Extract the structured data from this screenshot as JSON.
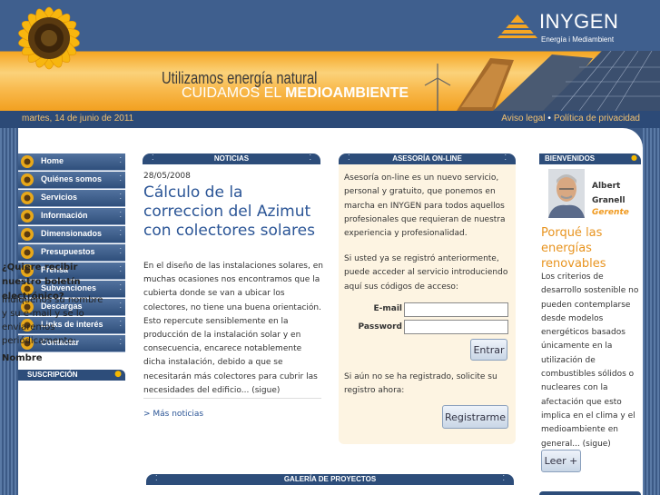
{
  "brand": {
    "name": "INYGEN",
    "tagline": "Energía i Mediambient"
  },
  "slogan": {
    "line1": "Utilizamos energía natural",
    "line2_prefix": "CUIDAMOS EL ",
    "line2_bold": "MEDIOAMBIENTE"
  },
  "datebar": {
    "date": "martes, 14 de junio de 2011",
    "links": [
      "Aviso legal",
      "Política de privacidad"
    ]
  },
  "nav": {
    "items": [
      "Home",
      "Quiénes somos",
      "Servicios",
      "Información",
      "Dimensionados",
      "Presupuestos",
      "Prensa",
      "Subvenciones",
      "Descargas",
      "Links de interés",
      "Contactar"
    ]
  },
  "suscripcion": {
    "header": "SUSCRIPCIÓN",
    "question": "¿Quiere recibir nuestro boletín electrónico?",
    "text": "Indiquenos su nombre y su e-mail y se lo enviaremos periódicamente:",
    "name_label": "Nombre"
  },
  "noticias": {
    "header": "NOTICIAS",
    "date": "28/05/2008",
    "title": "Cálculo de la correccion del Azimut con colectores solares",
    "body": "En el diseño de las instalaciones solares, en muchas ocasiones nos encontramos que la cubierta donde se van a ubicar los colectores, no tiene una buena orientación. Esto repercute sensiblemente en la producción de la instalación solar y en consecuencia, encarece notablemente dicha instalación, debido a que se necesitarán más colectores para cubrir las necesidades del edificio... (sigue)",
    "more": "> Más noticias"
  },
  "asesoria": {
    "header": "ASESORÍA ON-LINE",
    "text1": "Asesoría on-line es un nuevo servicio, personal y gratuito, que ponemos en marcha en INYGEN para todos aquellos profesionales que requieran de nuestra experiencia y profesionalidad.",
    "text2": "Si usted ya se registró anteriormente, puede acceder al servicio introduciendo aquí sus códigos de acceso:",
    "email_label": "E-mail",
    "password_label": "Password",
    "email_value": "",
    "password_value": "",
    "login_button": "Entrar",
    "text3": "Si aún no se ha registrado, solicite su registro ahora:",
    "register_button": "Registrarme"
  },
  "bienvenidos": {
    "header": "BIENVENIDOS",
    "name": "Albert Granell",
    "role": "Gerente",
    "title": "Porqué las energías renovables",
    "body": "Los criterios de desarrollo sostenible no pueden contemplarse desde modelos energéticos basados únicamente en la utilización de combustibles sólidos o nucleares con la afectación que esto implica en el clima y el medioambiente en general... (sigue)",
    "button": "Leer +"
  },
  "galeria": {
    "header": "GALERÍA DE PROYECTOS"
  },
  "colors": {
    "navy": "#2d4d7a",
    "orange": "#f09a20",
    "link_blue": "#2b5596",
    "cream": "#fdf4e2"
  }
}
